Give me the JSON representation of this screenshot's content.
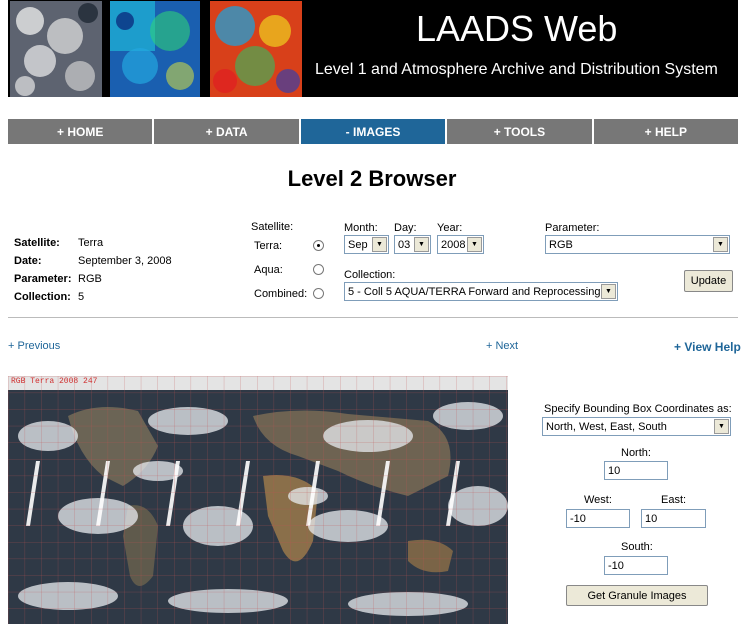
{
  "banner": {
    "title": "LAADS Web",
    "subtitle": "Level 1 and Atmosphere Archive and Distribution System"
  },
  "nav": [
    {
      "label": "+ HOME",
      "active": false
    },
    {
      "label": "+ DATA",
      "active": false
    },
    {
      "label": "- IMAGES",
      "active": true
    },
    {
      "label": "+ TOOLS",
      "active": false
    },
    {
      "label": "+ HELP",
      "active": false
    }
  ],
  "page_title": "Level 2 Browser",
  "info": {
    "satellite_label": "Satellite:",
    "satellite_value": "Terra",
    "date_label": "Date:",
    "date_value": "September 3, 2008",
    "parameter_label": "Parameter:",
    "parameter_value": "RGB",
    "collection_label": "Collection:",
    "collection_value": "5"
  },
  "satellite_picker": {
    "heading": "Satellite:",
    "options": [
      {
        "label": "Terra:",
        "checked": true
      },
      {
        "label": "Aqua:",
        "checked": false
      },
      {
        "label": "Combined:",
        "checked": false
      }
    ]
  },
  "date_picker": {
    "month_label": "Month:",
    "month_value": "Sep",
    "day_label": "Day:",
    "day_value": "03",
    "year_label": "Year:",
    "year_value": "2008"
  },
  "collection_picker": {
    "label": "Collection:",
    "value": "5 - Coll 5 AQUA/TERRA Forward and Reprocessing"
  },
  "parameter_picker": {
    "label": "Parameter:",
    "value": "RGB"
  },
  "update_button": "Update",
  "links": {
    "previous": "+ Previous",
    "next": "+ Next",
    "view_help": "+ View Help"
  },
  "map": {
    "label": "RGB Terra 2008 247"
  },
  "bbox": {
    "heading": "Specify Bounding Box Coordinates as:",
    "format_value": "North, West, East, South",
    "north_label": "North:",
    "north_value": "10",
    "west_label": "West:",
    "west_value": "-10",
    "east_label": "East:",
    "east_value": "10",
    "south_label": "South:",
    "south_value": "-10",
    "submit_label": "Get Granule Images"
  },
  "colors": {
    "nav_bg": "#777777",
    "nav_active": "#1f6699",
    "link": "#1f6699",
    "banner_bg": "#000000"
  }
}
